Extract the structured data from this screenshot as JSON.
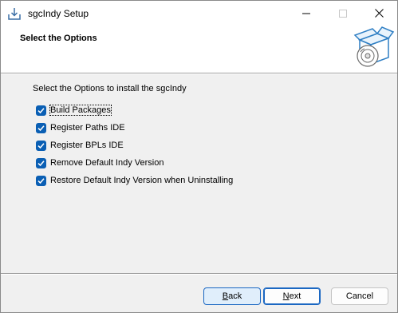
{
  "window": {
    "title": "sgcIndy Setup"
  },
  "header": {
    "title": "Select the Options"
  },
  "body": {
    "intro": "Select the Options to install the sgcIndy",
    "options": [
      {
        "label": "Build Packages",
        "checked": true
      },
      {
        "label": "Register Paths IDE",
        "checked": true
      },
      {
        "label": "Register BPLs IDE",
        "checked": true
      },
      {
        "label": "Remove Default Indy Version",
        "checked": true
      },
      {
        "label": "Restore Default Indy Version when Uninstalling",
        "checked": true
      }
    ]
  },
  "footer": {
    "back_hotkey": "B",
    "back_rest": "ack",
    "next_hotkey": "N",
    "next_rest": "ext",
    "cancel_label": "Cancel"
  },
  "colors": {
    "checkbox": "#0a5fb4",
    "accent": "#1b67c2"
  }
}
